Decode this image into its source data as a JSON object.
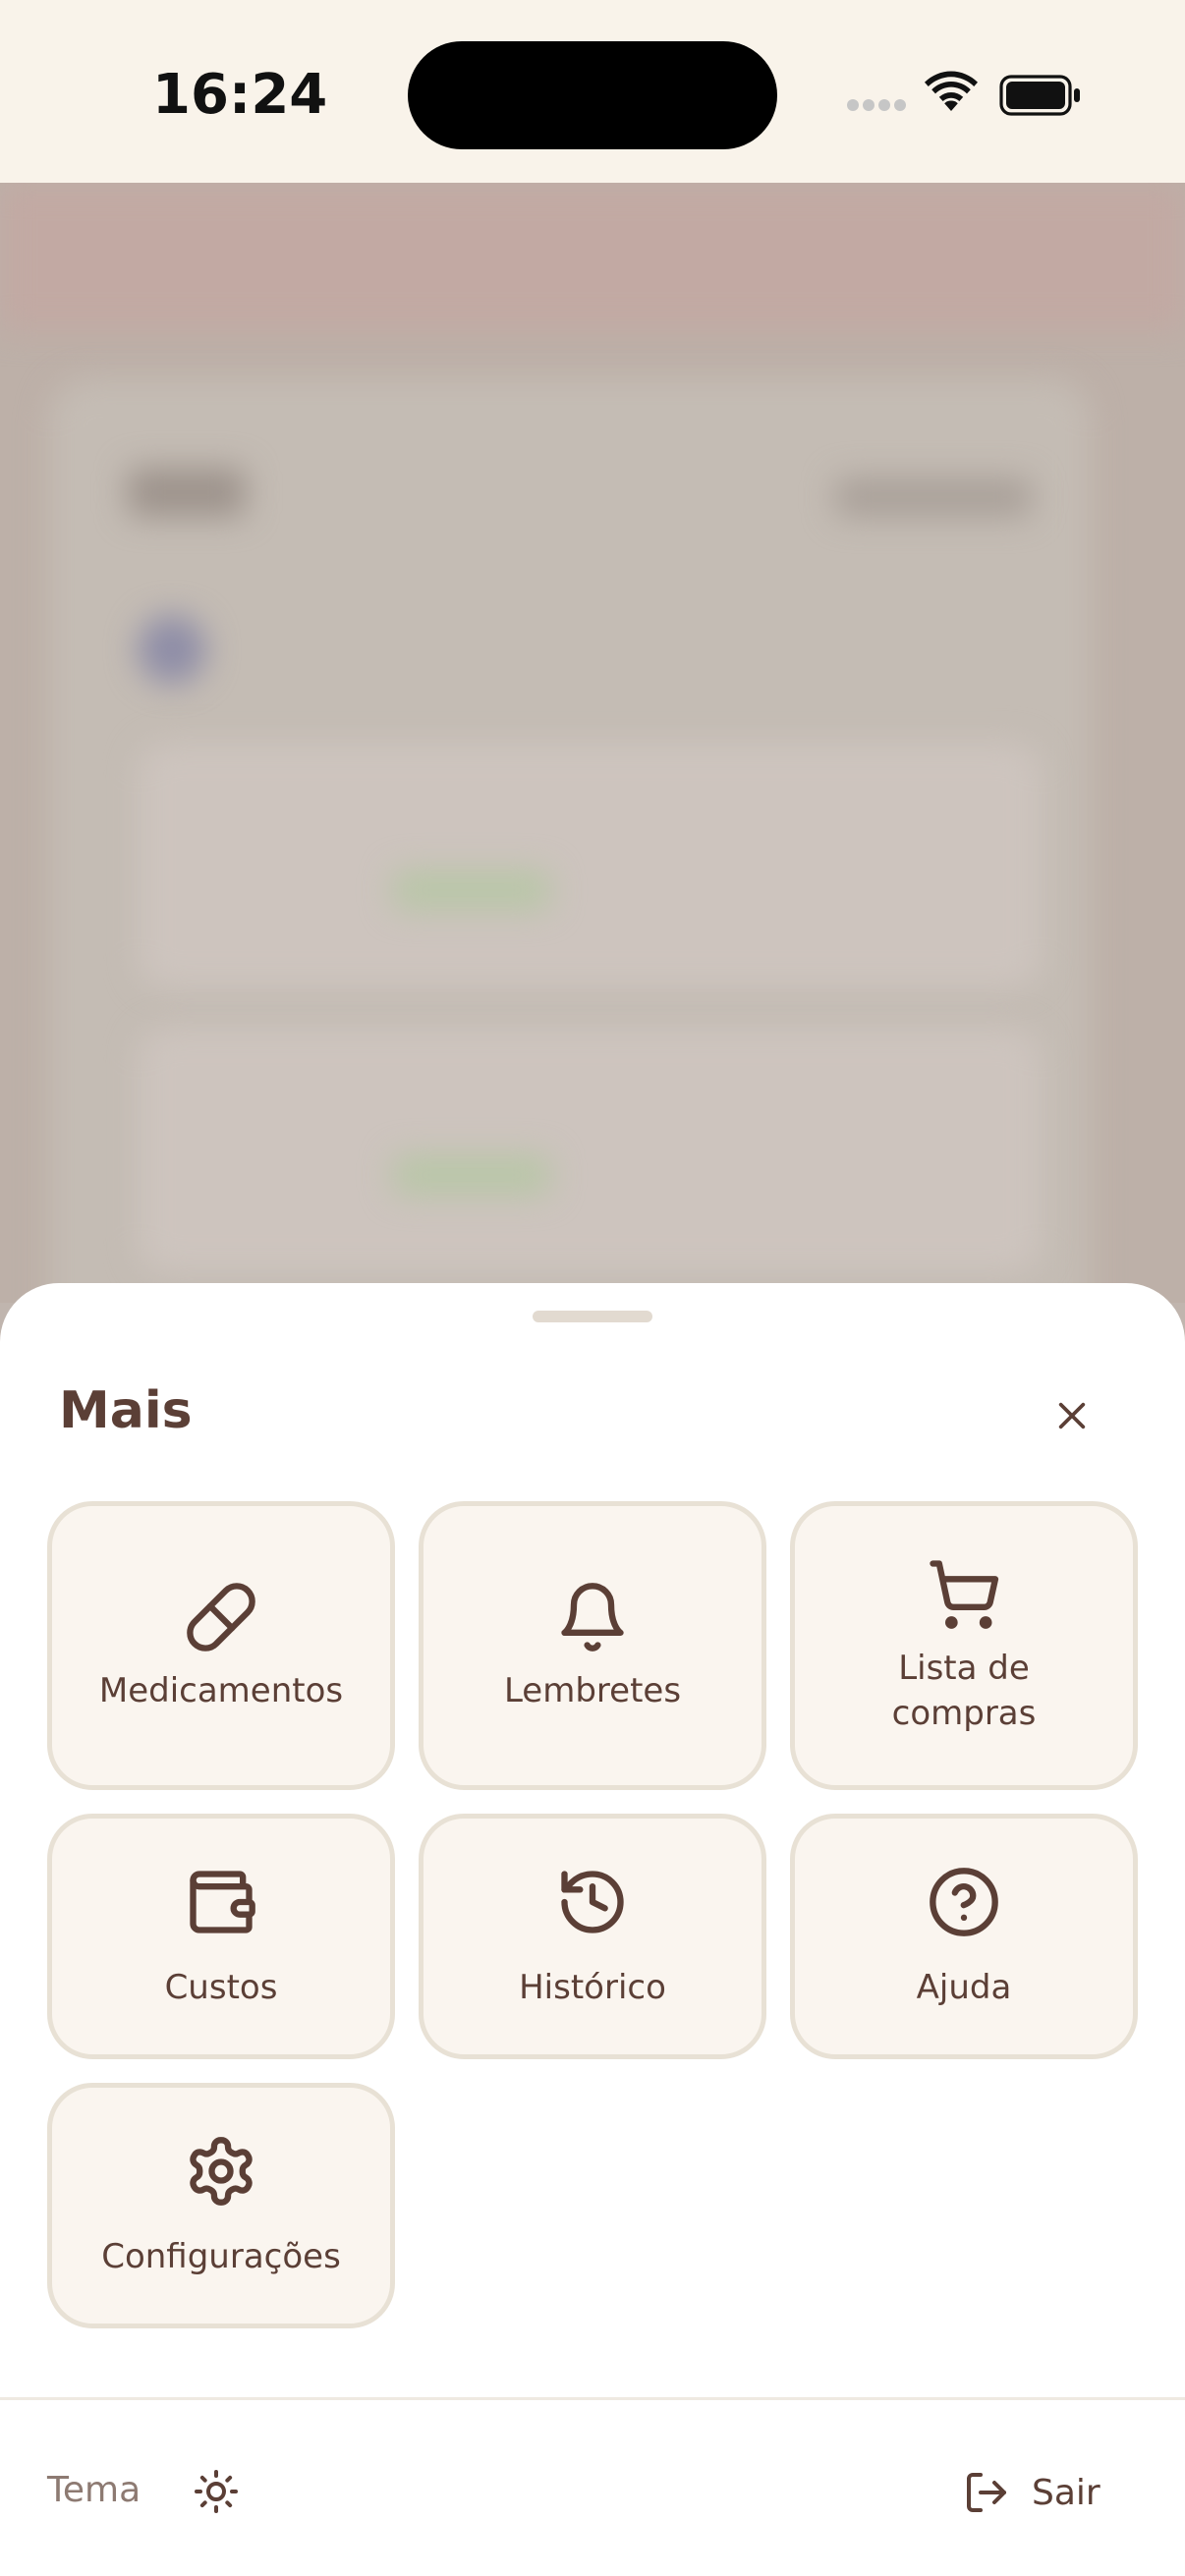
{
  "status_bar": {
    "time": "16:24"
  },
  "sheet": {
    "title": "Mais",
    "items": [
      {
        "label": "Medicamentos",
        "icon": "pill-icon"
      },
      {
        "label": "Lembretes",
        "icon": "bell-icon"
      },
      {
        "label": "Lista de\ncompras",
        "icon": "cart-icon"
      },
      {
        "label": "Custos",
        "icon": "wallet-icon"
      },
      {
        "label": "Histórico",
        "icon": "history-icon"
      },
      {
        "label": "Ajuda",
        "icon": "help-icon"
      },
      {
        "label": "Configurações",
        "icon": "gear-icon"
      }
    ],
    "footer": {
      "theme_label": "Tema",
      "logout_label": "Sair"
    }
  },
  "colors": {
    "accent": "#5b3f36",
    "tile_bg": "#faf5ef",
    "tile_border": "#e8e1d5",
    "status_bg": "#f9f3ea"
  }
}
